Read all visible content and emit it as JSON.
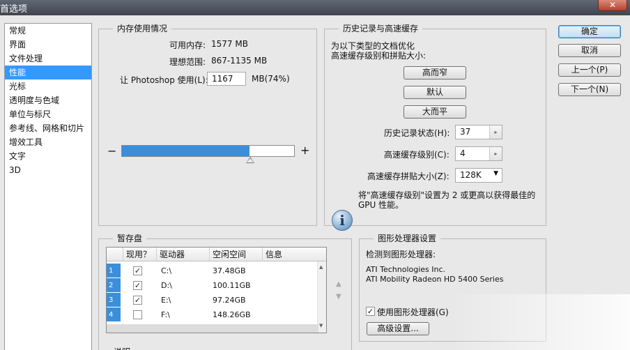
{
  "window": {
    "title": "首选项",
    "close_glyph": "✕"
  },
  "nav": {
    "items": [
      "常规",
      "界面",
      "文件处理",
      "性能",
      "光标",
      "透明度与色域",
      "单位与标尺",
      "参考线、网格和切片",
      "增效工具",
      "文字",
      "3D"
    ],
    "selected_index": 3
  },
  "memory": {
    "title": "内存使用情况",
    "available_label": "可用内存:",
    "available_value": "1577 MB",
    "ideal_label": "理想范围:",
    "ideal_value": "867-1135 MB",
    "let_label": "让 Photoshop 使用(L):",
    "let_value": "1167",
    "let_unit": "MB(74%)",
    "minus": "−",
    "plus": "+",
    "slider_fraction": 0.74
  },
  "history": {
    "title": "历史记录与高速缓存",
    "desc_line1": "为以下类型的文档优化",
    "desc_line2": "高速缓存级别和拼贴大小:",
    "btn_tall_thin": "高而窄",
    "btn_default": "默认",
    "btn_big_flat": "大而平",
    "states_label": "历史记录状态(H):",
    "states_value": "37",
    "cache_levels_label": "高速缓存级别(C):",
    "cache_levels_value": "4",
    "tile_size_label": "高速缓存拼贴大小(Z):",
    "tile_size_value": "128K",
    "info_line1": "将\"高速缓存级别\"设置为 2 或更高以获得最佳的",
    "info_line2": "GPU 性能。",
    "info_glyph": "i"
  },
  "scratch": {
    "title": "暂存盘",
    "columns": [
      "现用？",
      "驱动器",
      "空闲空间",
      "信息"
    ],
    "rows": [
      {
        "num": "1",
        "active": true,
        "drive": "C:\\",
        "free": "37.48GB",
        "info": ""
      },
      {
        "num": "2",
        "active": true,
        "drive": "D:\\",
        "free": "100.11GB",
        "info": ""
      },
      {
        "num": "3",
        "active": true,
        "drive": "E:\\",
        "free": "97.24GB",
        "info": ""
      },
      {
        "num": "4",
        "active": false,
        "drive": "F:\\",
        "free": "148.26GB",
        "info": ""
      }
    ],
    "check_glyph": "✓",
    "move_up_glyph": "▲",
    "move_down_glyph": "▼"
  },
  "gpu": {
    "title": "图形处理器设置",
    "detected_label": "检测到图形处理器:",
    "vendor": "ATI Technologies Inc.",
    "model": "ATI Mobility Radeon HD 5400 Series",
    "use_gpu_label": "使用图形处理器(G)",
    "use_gpu_checked": true,
    "advanced_button": "高级设置..."
  },
  "actions": {
    "ok": "确定",
    "cancel": "取消",
    "prev": "上一个(P)",
    "next": "下一个(N)"
  },
  "footer": {
    "desc_label": "说明"
  }
}
